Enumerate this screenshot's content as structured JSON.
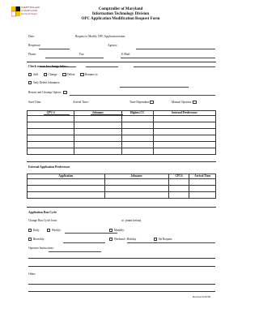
{
  "logo": {
    "line1": "COMPTROLLER",
    "line2": "of MARYLAND",
    "line3": "Serving the People"
  },
  "header": {
    "title1": "Comptroller of Maryland",
    "title2": "Information Technology Division",
    "title3": "OPC Application Modification Request Form"
  },
  "fields": {
    "date": "Date:",
    "request_to_modify": "Request to Modify OPC Application name:",
    "requestor": "Requestor:",
    "agency": "Agency:",
    "phone": "Phone:",
    "fax": "Fax:",
    "email": "E-Mail:"
  },
  "reason": {
    "heading": "Check reason for change below:",
    "add": "Add",
    "change": "Change",
    "delete": "Delete",
    "rename_to": "Rename to",
    "only_delete_jobnames": "Only Delete Jobnames:",
    "restart": "Restart and Cleanup Option:",
    "start_time": "Start Time:",
    "arrival_time": "Arrival Time:",
    "time_dependent": "Time Dependent",
    "manual_operator": "Manual Operator"
  },
  "table1": {
    "headers": [
      "CPU #",
      "Jobname",
      "Highest CC",
      "Internal Predecessor"
    ],
    "rows": 6
  },
  "external": {
    "heading": "External Application Predecessor"
  },
  "table2": {
    "headers": [
      "Application",
      "Jobname",
      "CPU#",
      "Arrival Time"
    ],
    "rows": 3
  },
  "runcycle": {
    "heading": "Application Run Cycle",
    "change_from": "Change Run Cycle from:",
    "to_label": "to:",
    "to_hint": "(mark below)",
    "daily": "Daily",
    "weekly": "Weekly:",
    "monthly": "Monthly:",
    "biweekly": "Biweekly:",
    "weekend_holiday": "Weekend / Holiday",
    "on_request": "On Request",
    "operator_instructions": "Operator Instructions:",
    "other": "Other:"
  },
  "footer": {
    "revised": "Revised 6/29/06"
  }
}
